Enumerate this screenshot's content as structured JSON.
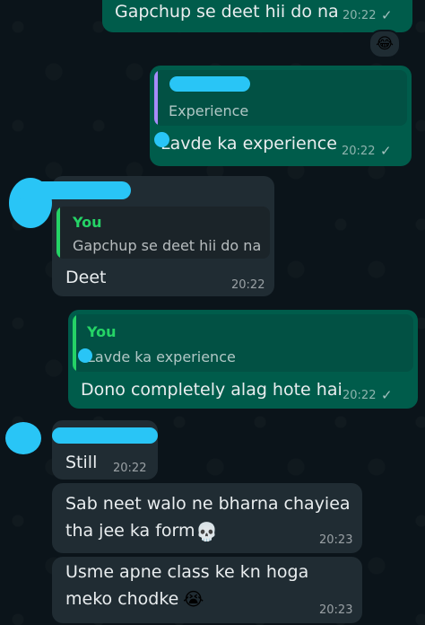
{
  "colors": {
    "background": "#0b141a",
    "outgoing_bubble": "#005c4b",
    "incoming_bubble": "#202c33",
    "you_label": "#25d366",
    "quote_bar_purple": "#a78bfa",
    "redaction": "#29c5f6"
  },
  "messages": [
    {
      "id": "m1",
      "direction": "outgoing",
      "text": "Gapchup se deet hii do na",
      "time": "20:22",
      "status": "sent",
      "reaction": "😂"
    },
    {
      "id": "m2",
      "direction": "outgoing",
      "quote": {
        "author": "",
        "text": "Experience"
      },
      "text": "Lavde ka experience",
      "time": "20:22",
      "status": "sent"
    },
    {
      "id": "m3",
      "direction": "incoming",
      "quote": {
        "author": "You",
        "text": "Gapchup se deet hii do na"
      },
      "text": "Deet",
      "time": "20:22"
    },
    {
      "id": "m4",
      "direction": "outgoing",
      "quote": {
        "author": "You",
        "text": "Lavde ka experience"
      },
      "text": "Dono completely alag hote hai",
      "time": "20:22",
      "status": "sent"
    },
    {
      "id": "m5",
      "direction": "incoming",
      "text": "Still",
      "time": "20:22"
    },
    {
      "id": "m6",
      "direction": "incoming",
      "text_lines": [
        "Sab neet walo ne bharna chayiea",
        "tha jee ka form"
      ],
      "emoji": "💀",
      "time": "20:23"
    },
    {
      "id": "m7",
      "direction": "incoming",
      "text_lines": [
        "Usme apne class ke kn hoga",
        "meko chodke"
      ],
      "emoji": "😭",
      "time": "20:23"
    }
  ],
  "icons": {
    "check": "✓",
    "check_name": "single-check-icon"
  }
}
